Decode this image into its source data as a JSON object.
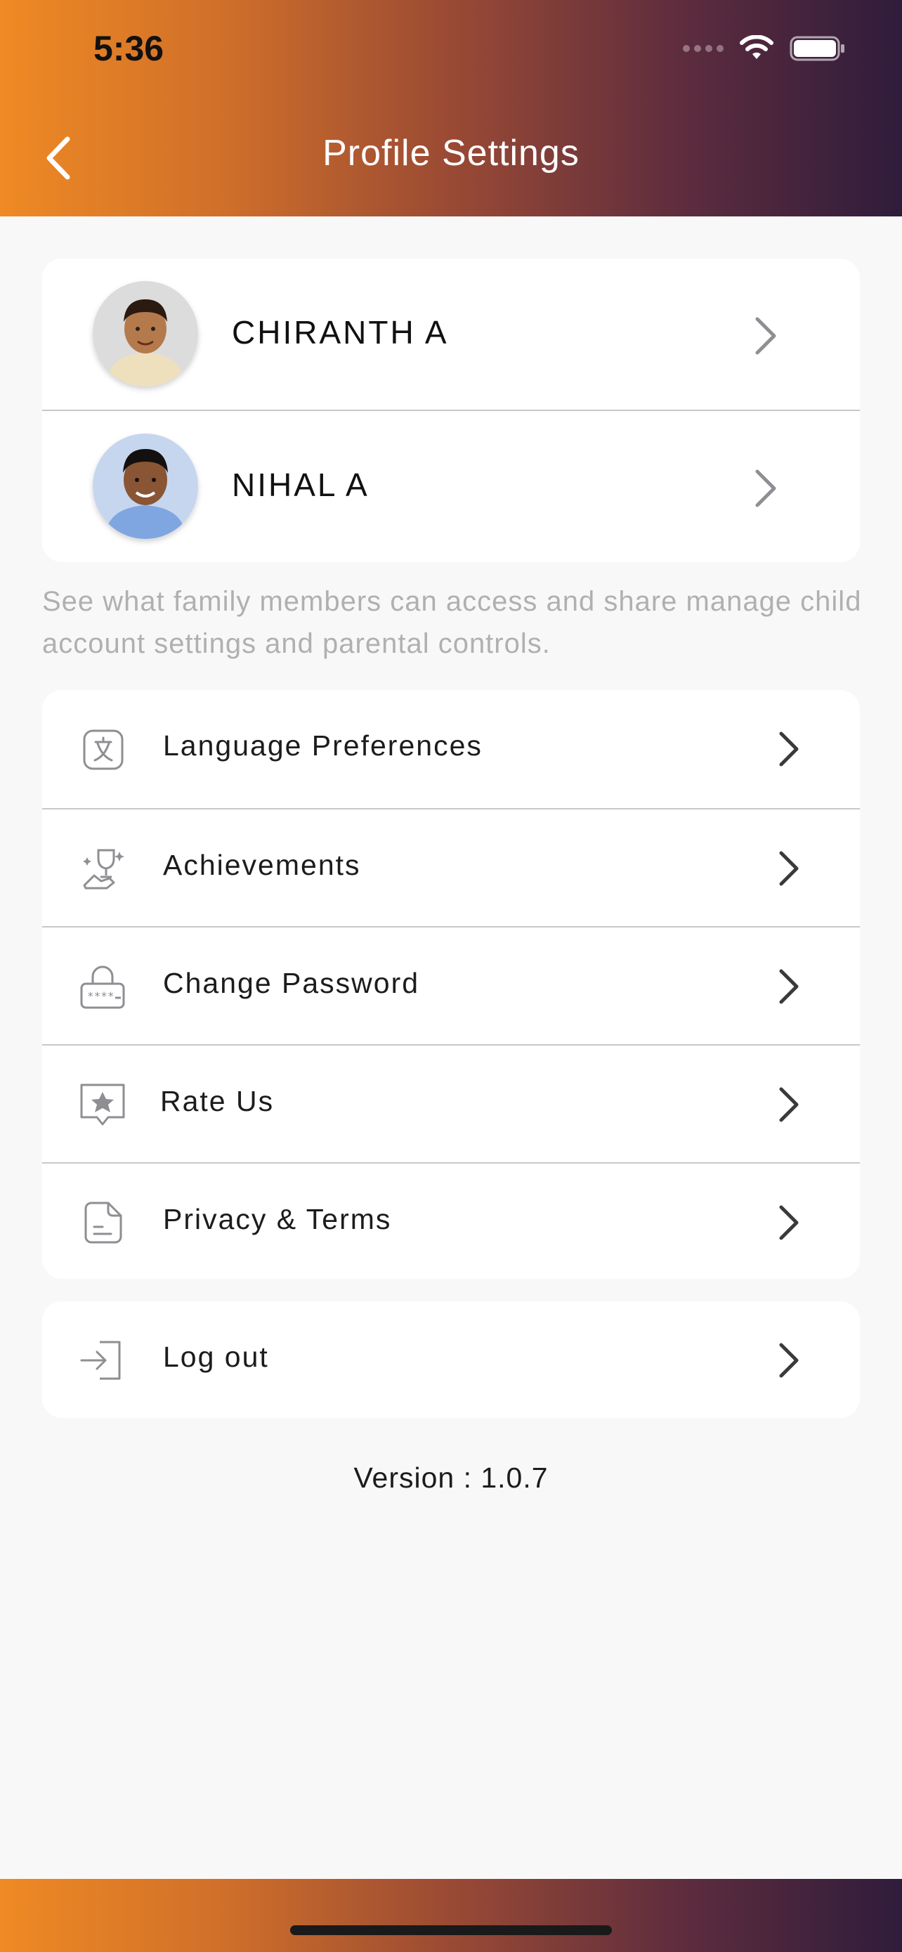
{
  "status_bar": {
    "time": "5:36"
  },
  "header": {
    "title": "Profile Settings",
    "back_icon": "chevron-left-icon"
  },
  "profiles": [
    {
      "name": "CHIRANTH A"
    },
    {
      "name": "NIHAL A"
    }
  ],
  "description": "See what family members can access and share manage child account settings  and parental controls.",
  "menu": [
    {
      "label": "Language Preferences",
      "icon": "language-icon"
    },
    {
      "label": "Achievements",
      "icon": "trophy-icon"
    },
    {
      "label": "Change Password",
      "icon": "lock-icon"
    },
    {
      "label": "Rate Us",
      "icon": "star-badge-icon"
    },
    {
      "label": "Privacy & Terms",
      "icon": "document-icon"
    }
  ],
  "logout": {
    "label": "Log out",
    "icon": "logout-icon"
  },
  "version": "Version : 1.0.7",
  "colors": {
    "gradient_start": "#ef8a24",
    "gradient_end": "#2f1c3c"
  }
}
